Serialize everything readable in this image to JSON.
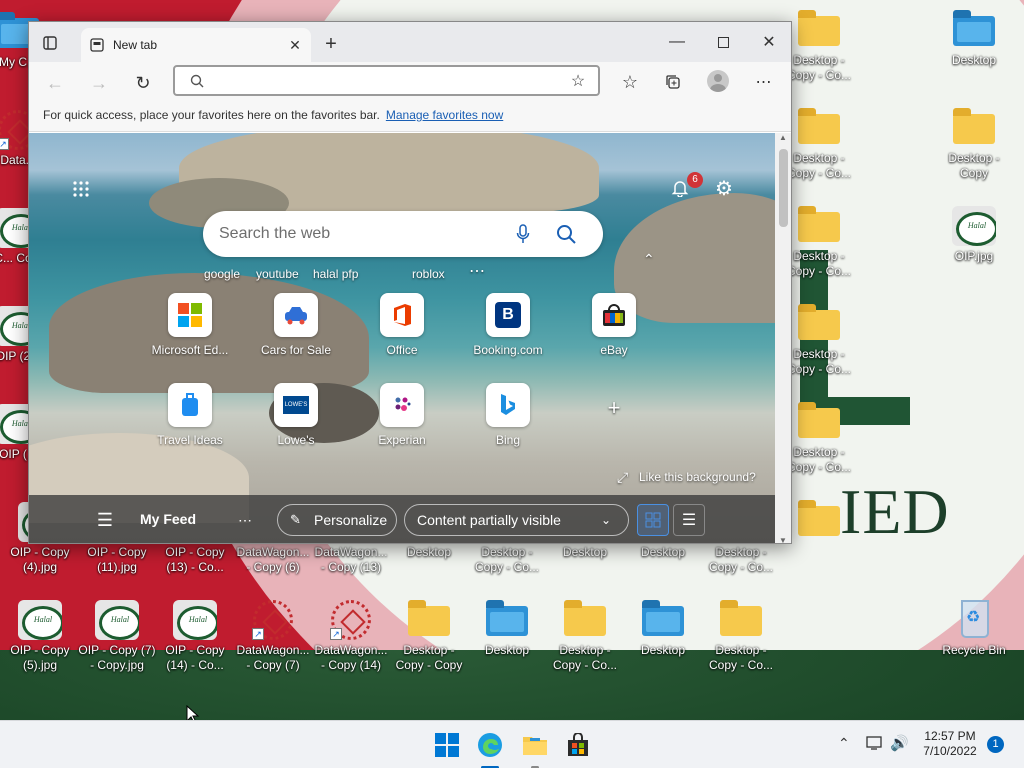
{
  "desktop": {
    "icons": [
      {
        "label": "My C...",
        "kind": "pc"
      },
      {
        "label": "Data...",
        "kind": "flower"
      },
      {
        "label": "C... Co...",
        "kind": "oip"
      },
      {
        "label": "OIP (2...",
        "kind": "oip"
      },
      {
        "label": "OIP (...",
        "kind": "oip"
      },
      {
        "label": "OIP - Copy (4).jpg",
        "kind": "oip"
      },
      {
        "label": "OIP - Copy (11).jpg",
        "kind": "oip"
      },
      {
        "label": "OIP - Copy (13) - Co...",
        "kind": "oip"
      },
      {
        "label": "DataWagon... - Copy (6)",
        "kind": "flower"
      },
      {
        "label": "DataWagon... - Copy (13)",
        "kind": "flower"
      },
      {
        "label": "Desktop",
        "kind": "blue"
      },
      {
        "label": "Desktop - Copy - Co...",
        "kind": "folder"
      },
      {
        "label": "Desktop",
        "kind": "blue"
      },
      {
        "label": "Desktop",
        "kind": "blue"
      },
      {
        "label": "Desktop - Copy - Co...",
        "kind": "folder"
      },
      {
        "label": "OIP - Copy (5).jpg",
        "kind": "oip"
      },
      {
        "label": "OIP - Copy (7) - Copy.jpg",
        "kind": "oip"
      },
      {
        "label": "OIP - Copy (14) - Co...",
        "kind": "oip"
      },
      {
        "label": "DataWagon... - Copy (7)",
        "kind": "flower"
      },
      {
        "label": "DataWagon... - Copy (14)",
        "kind": "flower"
      },
      {
        "label": "Desktop - Copy - Copy",
        "kind": "folder"
      },
      {
        "label": "Desktop",
        "kind": "blue"
      },
      {
        "label": "Desktop - Copy - Co...",
        "kind": "folder"
      },
      {
        "label": "Desktop",
        "kind": "blue"
      },
      {
        "label": "Desktop - Copy - Co...",
        "kind": "folder"
      },
      {
        "label": "Desktop - Copy - Co...",
        "kind": "folder"
      },
      {
        "label": "Desktop - Copy - Co...",
        "kind": "folder"
      },
      {
        "label": "Desktop - Copy - Co...",
        "kind": "folder"
      },
      {
        "label": "Desktop - Copy - Co...",
        "kind": "folder"
      },
      {
        "label": "Desktop - Copy - Co...",
        "kind": "folder"
      },
      {
        "label": "Desktop",
        "kind": "blue"
      },
      {
        "label": "Desktop - Copy",
        "kind": "folder"
      },
      {
        "label": "OIP.jpg",
        "kind": "oip"
      },
      {
        "label": "Recycle Bin",
        "kind": "recycle"
      }
    ]
  },
  "browser": {
    "tab_title": "New tab",
    "address_value": "",
    "favorites_bar_text": "For quick access, place your favorites here on the favorites bar.",
    "favorites_bar_link": "Manage favorites now",
    "notification_count": "6",
    "search_placeholder": "Search the web",
    "suggestions": [
      "google",
      "youtube",
      "halal pfp",
      "roblox"
    ],
    "tiles": [
      {
        "label": "Microsoft Ed...",
        "icon": "microsoft-icon"
      },
      {
        "label": "Cars for Sale",
        "icon": "car-icon"
      },
      {
        "label": "Office",
        "icon": "office-icon"
      },
      {
        "label": "Booking.com",
        "icon": "booking-icon"
      },
      {
        "label": "eBay",
        "icon": "ebay-icon"
      },
      {
        "label": "Travel Ideas",
        "icon": "luggage-icon"
      },
      {
        "label": "Lowe's",
        "icon": "lowes-icon"
      },
      {
        "label": "Experian",
        "icon": "experian-icon"
      },
      {
        "label": "Bing",
        "icon": "bing-icon"
      }
    ],
    "background_prompt": "Like this background?",
    "feed": {
      "title": "My Feed",
      "personalize": "Personalize",
      "content_visibility": "Content partially visible"
    }
  },
  "taskbar": {
    "time": "12:57 PM",
    "date": "7/10/2022",
    "notification_count": "1"
  }
}
